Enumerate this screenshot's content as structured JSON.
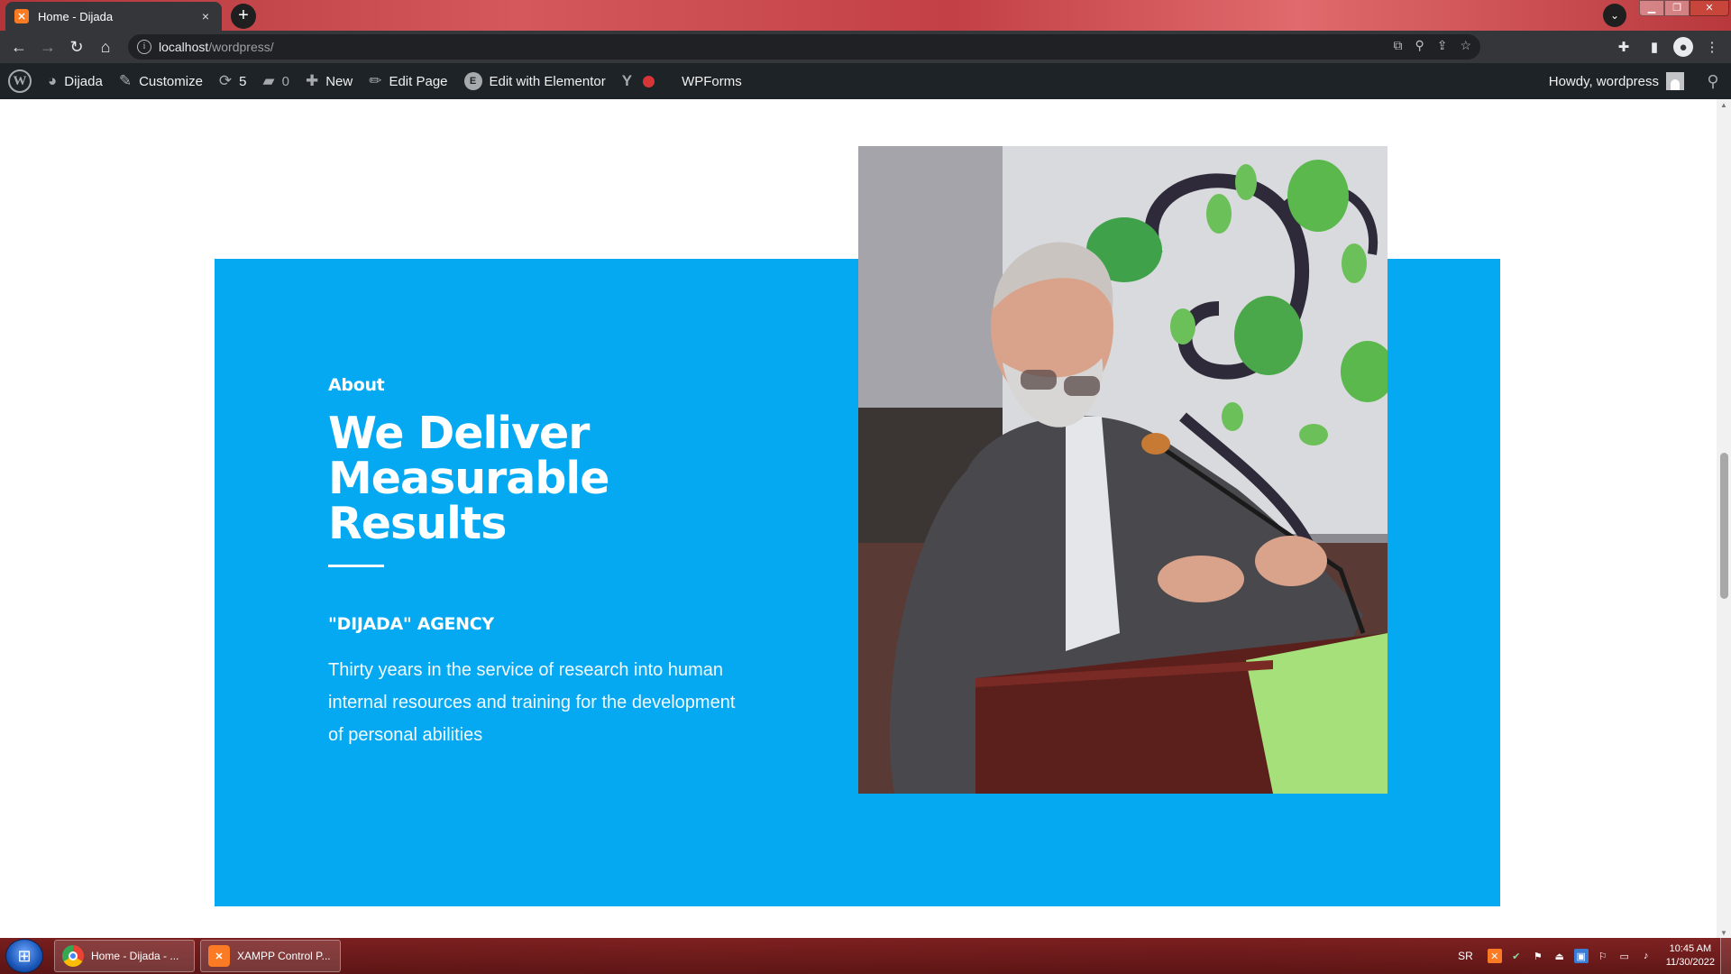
{
  "browser": {
    "tab": {
      "title": "Home - Dijada",
      "close": "×"
    },
    "new_tab": "+",
    "tab_search": "⌄",
    "address": {
      "host": "localhost",
      "path": "/wordpress/"
    },
    "window_controls": {
      "minimize": "▁",
      "maximize": "❐",
      "close": "✕"
    }
  },
  "admin_bar": {
    "site_name": "Dijada",
    "customize": "Customize",
    "updates_count": "5",
    "comments_count": "0",
    "new": "New",
    "edit_page": "Edit Page",
    "edit_elementor": "Edit with Elementor",
    "wpforms": "WPForms",
    "greeting": "Howdy, wordpress"
  },
  "about": {
    "eyebrow": "About",
    "headline_line1": "We Deliver",
    "headline_line2": "Measurable",
    "headline_line3": "Results",
    "agency": "\"DIJADA\" AGENCY",
    "description": "Thirty years in the service of research into human internal resources and training for the development of personal abilities"
  },
  "colors": {
    "accent_blue": "#05a9f2",
    "admin_bar": "#1d2327",
    "browser_toolbar": "#35363a",
    "wpforms_dot": "#d63638"
  },
  "taskbar": {
    "items": [
      {
        "label": "Home - Dijada - ...",
        "icon": "chrome-icon"
      },
      {
        "label": "XAMPP Control P...",
        "icon": "xampp-icon"
      }
    ],
    "language": "SR",
    "time": "10:45 AM",
    "date": "11/30/2022"
  }
}
